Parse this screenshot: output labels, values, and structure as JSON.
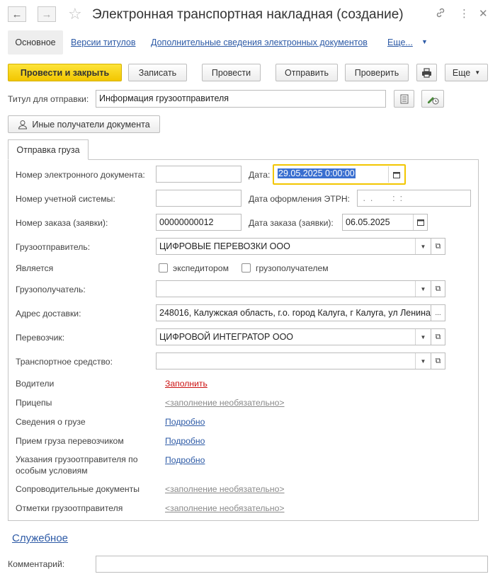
{
  "window": {
    "title": "Электронная транспортная накладная (создание)",
    "back_icon": "arrow-left-icon",
    "forward_icon": "arrow-right-icon",
    "favorite_icon": "star-icon",
    "link_icon": "link-icon",
    "more_icon": "vertical-dots-icon",
    "close_icon": "close-icon"
  },
  "sections": {
    "main": "Основное",
    "versions": "Версии титулов",
    "extra_info": "Дополнительные сведения электронных документов",
    "more": "Еще..."
  },
  "toolbar": {
    "post_close": "Провести и закрыть",
    "save": "Записать",
    "post": "Провести",
    "send": "Отправить",
    "check": "Проверить",
    "more": "Еще"
  },
  "title_row": {
    "label": "Титул для отправки:",
    "value": "Информация грузоотправителя"
  },
  "other_recipients": "Иные получатели документа",
  "tab": "Отправка груза",
  "form": {
    "doc_number_label": "Номер электронного документа:",
    "doc_number_value": "",
    "date_label": "Дата:",
    "date_value": "29.05.2025  0:00:00",
    "account_number_label": "Номер учетной системы:",
    "account_number_value": "",
    "etrn_date_label": "Дата оформления ЭТРН:",
    "etrn_date_value": " .  .        :  :",
    "order_number_label": "Номер заказа (заявки):",
    "order_number_value": "00000000012",
    "order_date_label": "Дата заказа (заявки):",
    "order_date_value": "06.05.2025",
    "shipper_label": "Грузоотправитель:",
    "shipper_value": "ЦИФРОВЫЕ ПЕРЕВОЗКИ ООО",
    "is_label": "Является",
    "forwarder_label": "экспедитором",
    "consignee_cb_label": "грузополучателем",
    "consignee_label": "Грузополучатель:",
    "consignee_value": "",
    "address_label": "Адрес доставки:",
    "address_value": "248016, Калужская область, г.о. город Калуга, г Калуга, ул Ленина",
    "carrier_label": "Перевозчик:",
    "carrier_value": "ЦИФРОВОЙ ИНТЕГРАТОР ООО",
    "vehicle_label": "Транспортное средство:",
    "vehicle_value": "",
    "drivers_label": "Водители",
    "drivers_link": "Заполнить",
    "trailers_label": "Прицепы",
    "trailers_link": "<заполнение необязательно>",
    "cargo_label": "Сведения о грузе",
    "cargo_link": "Подробно",
    "acceptance_label": "Прием груза перевозчиком",
    "acceptance_link": "Подробно",
    "instructions_label_1": "Указания грузоотправителя по",
    "instructions_label_2": "особым условиям",
    "instructions_link": "Подробно",
    "docs_label": "Сопроводительные документы",
    "docs_link": "<заполнение необязательно>",
    "marks_label": "Отметки грузоотправителя",
    "marks_link": "<заполнение необязательно>"
  },
  "service_link": "Служебное",
  "comment_label": "Комментарий:",
  "comment_value": ""
}
